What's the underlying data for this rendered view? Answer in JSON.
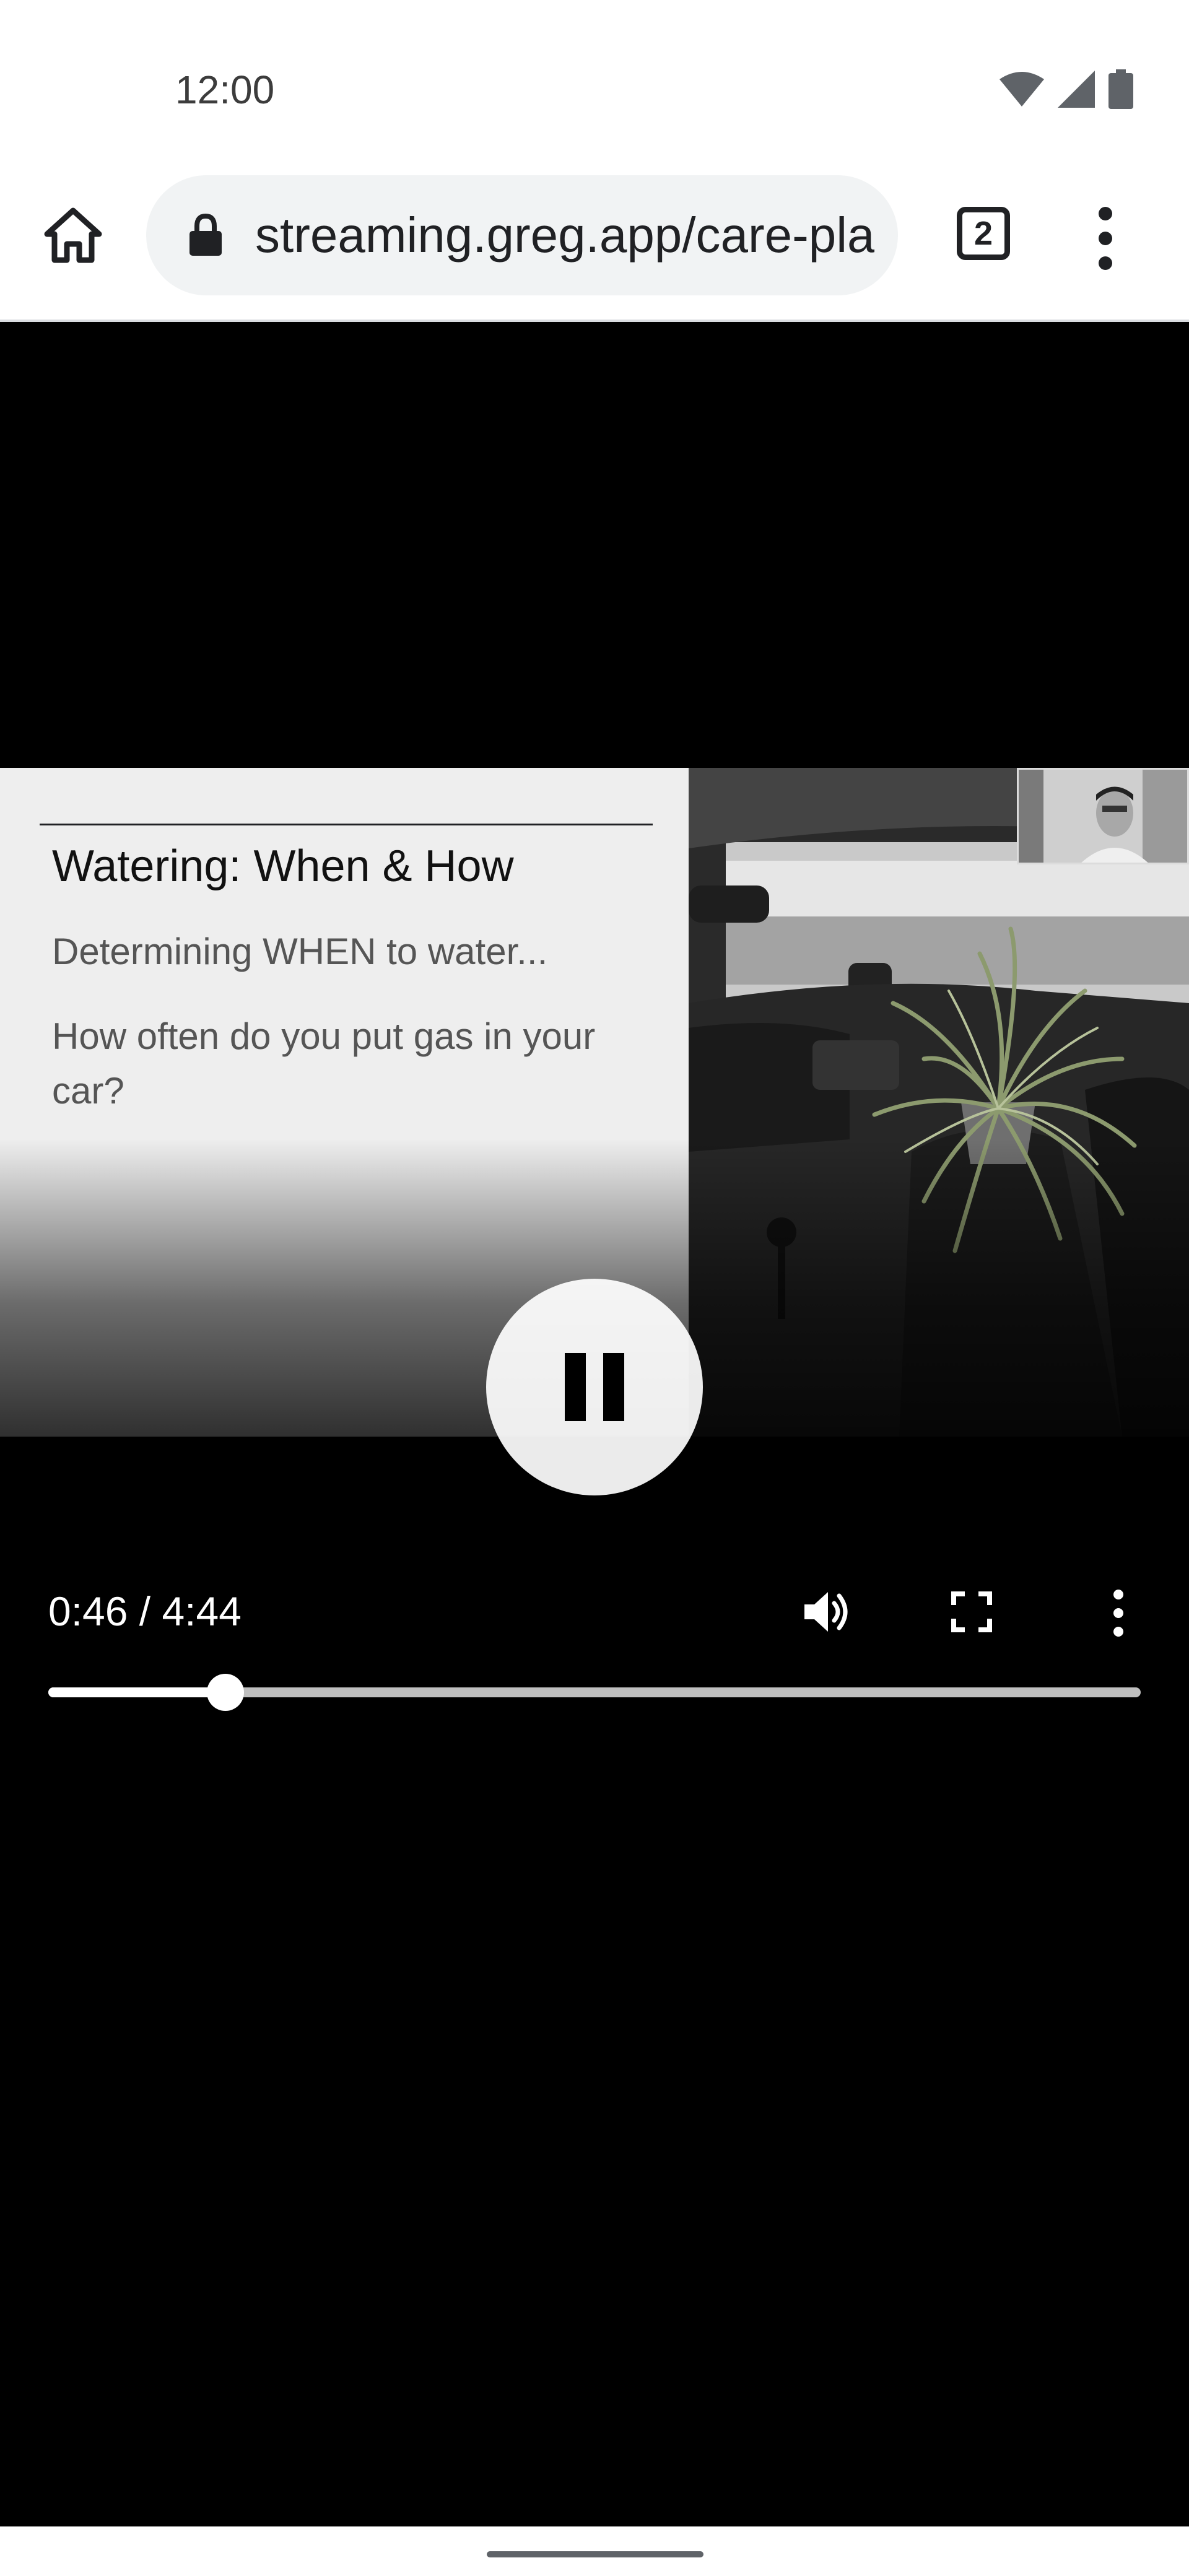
{
  "status_bar": {
    "time": "12:00",
    "icons": [
      "wifi-icon",
      "signal-icon",
      "battery-icon"
    ]
  },
  "browser": {
    "url": "streaming.greg.app/care-plan",
    "tab_count": "2",
    "icons": [
      "home-icon",
      "lock-icon",
      "tab-switcher-icon",
      "overflow-menu-icon"
    ]
  },
  "video": {
    "slide": {
      "title": "Watering: When & How",
      "line1": "Determining WHEN to water...",
      "line2": "How often do you put gas in your car?"
    },
    "controls": {
      "time": "0:46 / 4:44",
      "progress": 0.162,
      "state": "playing",
      "icons": [
        "pause-icon",
        "volume-icon",
        "fullscreen-icon",
        "more-options-icon"
      ]
    }
  },
  "colors": {
    "video_background": "#000000",
    "slide_background": "#eeeeee",
    "toolbar_background": "#ffffff",
    "url_bar_background": "#f1f3f4"
  }
}
